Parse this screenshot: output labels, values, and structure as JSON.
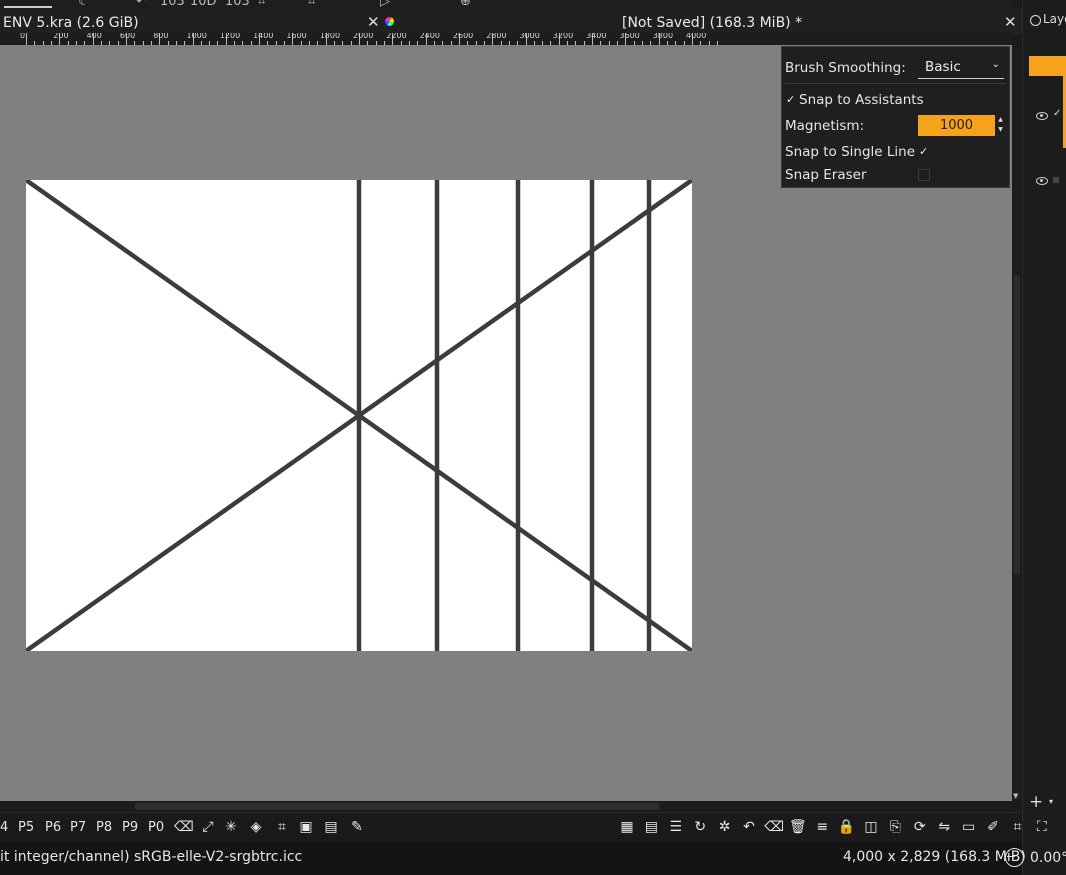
{
  "colors": {
    "accent": "#f7a21b",
    "canvas_bg": "#808080",
    "ui_bg": "#1b1b1b",
    "assistant_line": "#3c3c3c"
  },
  "tab": {
    "title": "ENV 5.kra (2.6 GiB)",
    "close_glyph": "✕",
    "status": "[Not Saved]  (168.3 MiB) *"
  },
  "ruler": {
    "labels": [
      "0",
      "200",
      "400",
      "600",
      "800",
      "1000",
      "1200",
      "1400",
      "1600",
      "1800",
      "2000",
      "2200",
      "2400",
      "2600",
      "2800",
      "3000",
      "3200",
      "3400",
      "3600",
      "3800",
      "4000"
    ]
  },
  "popup": {
    "brush_smoothing_label": "Brush Smoothing:",
    "brush_smoothing_value": "Basic",
    "snap_assistants_label": "Snap to Assistants",
    "snap_assistants_checked": true,
    "magnetism_label": "Magnetism:",
    "magnetism_value": "1000",
    "snap_single_line_label": "Snap to Single Line",
    "snap_single_line_checked": true,
    "snap_eraser_label": "Snap Eraser",
    "snap_eraser_checked": false
  },
  "panel": {
    "title": "Laye"
  },
  "presets": [
    "4",
    "P5",
    "P6",
    "P7",
    "P8",
    "P9",
    "P0"
  ],
  "tool_icons_left": [
    "eraser-icon",
    "transform-icon",
    "magic-wand-icon",
    "fill-icon",
    "crop-icon",
    "frame-icon",
    "gradient-icon",
    "brush-icon"
  ],
  "tool_icons_right": [
    "grid-icon",
    "grid-alt-icon",
    "list-icon",
    "redo-icon",
    "settings-icon",
    "undo-icon",
    "clear-icon",
    "delete-icon",
    "menu-icon",
    "lock-icon",
    "layers-icon",
    "copy-icon",
    "refresh-icon",
    "mirror-icon",
    "folder-icon",
    "pencil-icon",
    "crop-alt-icon",
    "frame-alt-icon"
  ],
  "status": {
    "color_info": "it integer/channel)  sRGB-elle-V2-srgbtrc.icc",
    "dimensions": "4,000 x 2,829 (168.3 MiB)",
    "rotation": "0.00°"
  }
}
